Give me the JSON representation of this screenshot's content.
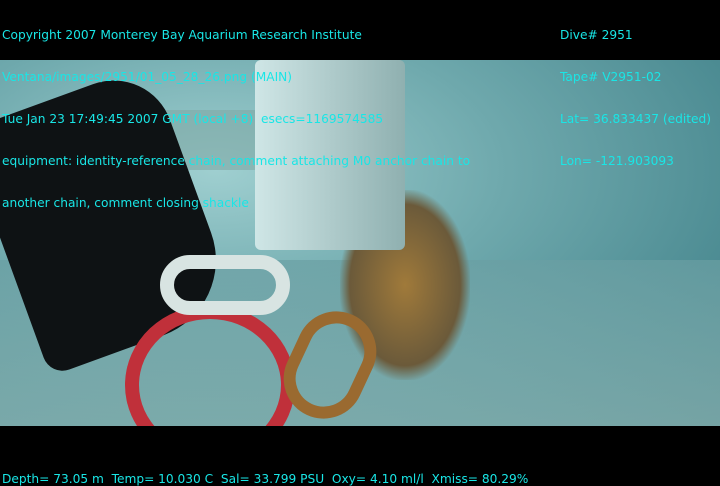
{
  "header_left": {
    "line1": "Copyright 2007 Monterey Bay Aquarium Research Institute",
    "line2": "Ventana/images/2951/01_05_28_26.png (MAIN)",
    "line3": "Tue Jan 23 17:49:45 2007 GMT (local +8)  esecs=1169574585",
    "line4": "equipment: identity-reference chain, comment attaching M0 anchor chain to",
    "line5": "another chain, comment closing shackle"
  },
  "header_right": {
    "dive": "Dive# 2951",
    "tape": "Tape# V2951-02",
    "lat": "Lat= 36.833437 (edited)",
    "lon": "Lon= -121.903093"
  },
  "footer": "Depth= 73.05 m  Temp= 10.030 C  Sal= 33.799 PSU  Oxy= 4.10 ml/l  Xmiss= 80.29%"
}
